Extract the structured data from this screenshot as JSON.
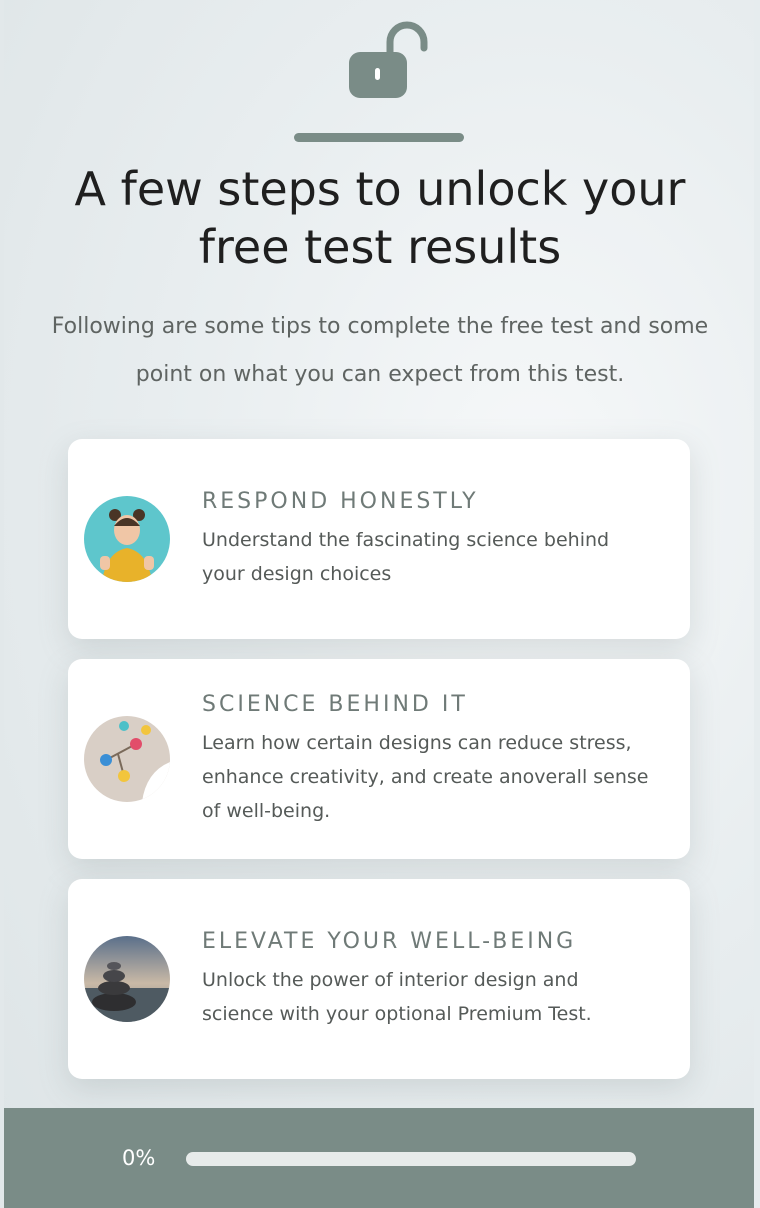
{
  "header": {
    "icon": "unlocked-padlock-icon",
    "title": "A few steps to unlock your free test results",
    "subtitle": "Following are some tips to complete the free test and some point on what you can expect from this test."
  },
  "cards": [
    {
      "heading": "RESPOND HONESTLY",
      "description": "Understand the fascinating science behind your design choices",
      "image": "woman-thumbs-up-photo"
    },
    {
      "heading": "SCIENCE BEHIND IT",
      "description": "Learn how certain designs can reduce stress, enhance creativity, and create anoverall sense of well-being.",
      "image": "molecule-model-photo"
    },
    {
      "heading": "ELEVATE YOUR WELL-BEING",
      "description": "Unlock the power of interior design and science with your optional Premium Test.",
      "image": "stacked-stones-beach-photo"
    }
  ],
  "progress": {
    "label": "0%",
    "value": 0
  },
  "colors": {
    "accent": "#7a8c87",
    "card": "#ffffff",
    "title": "#1f1f1f"
  }
}
